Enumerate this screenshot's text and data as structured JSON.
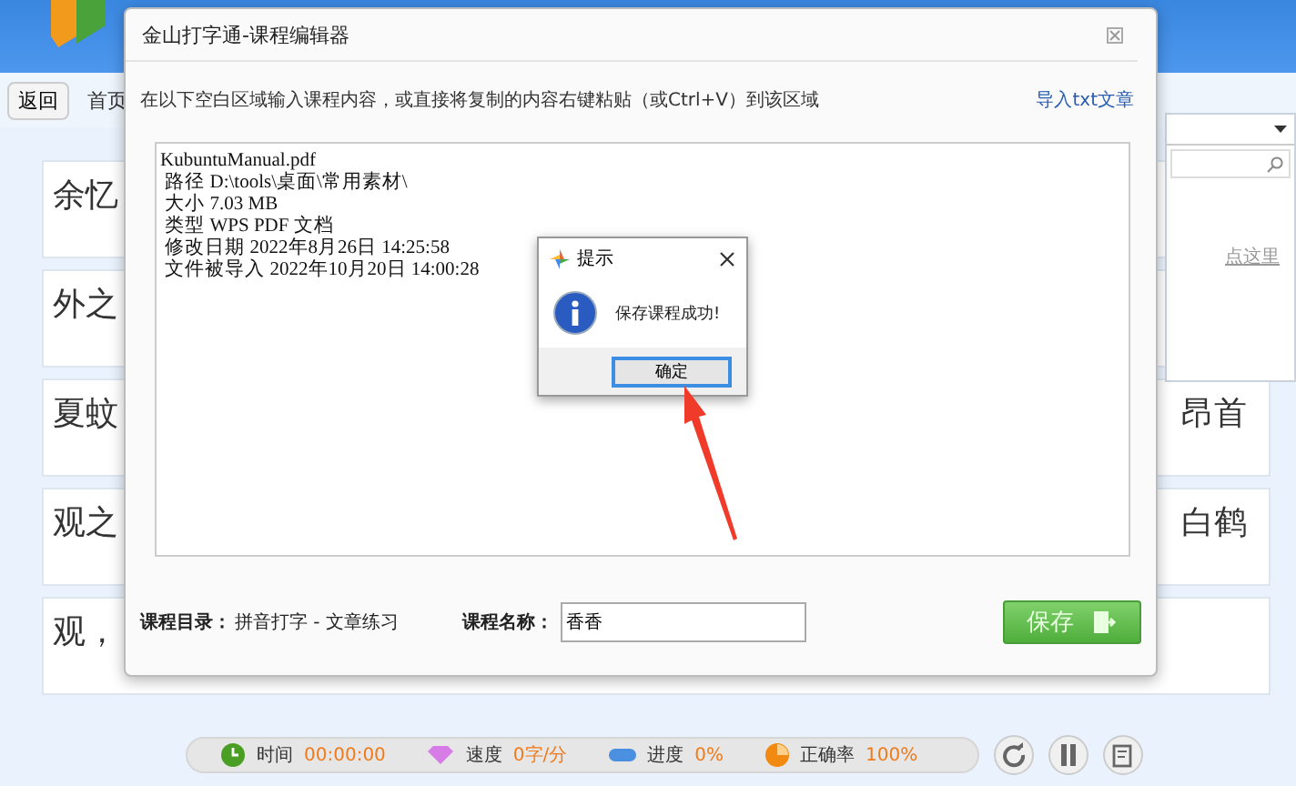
{
  "nav": {
    "back": "返回",
    "home": "首页"
  },
  "dropdown": {
    "link": "点这里"
  },
  "rows": [
    {
      "left": "余忆"
    },
    {
      "left": "外之"
    },
    {
      "left": "夏蚊",
      "right": "昂首"
    },
    {
      "left": "观之",
      "right": "白鹤"
    },
    {
      "left": "观，"
    }
  ],
  "status": [
    {
      "kind": "time",
      "label": "时间",
      "value": "00:00:00"
    },
    {
      "kind": "speed",
      "label": "速度",
      "value": "0字/分"
    },
    {
      "kind": "progress",
      "label": "进度",
      "value": "0%"
    },
    {
      "kind": "accuracy",
      "label": "正确率",
      "value": "100%"
    }
  ],
  "editor": {
    "title": "金山打字通-课程编辑器",
    "instruction": "在以下空白区域输入课程内容，或直接将复制的内容右键粘贴（或Ctrl+V）到该区域",
    "import_link": "导入txt文章",
    "content": [
      "KubuntuManual.pdf",
      " 路径 D:\\tools\\桌面\\常用素材\\",
      " 大小 7.03 MB",
      " 类型 WPS PDF 文档",
      " 修改日期 2022年8月26日 14:25:58",
      " 文件被导入 2022年10月20日 14:00:28"
    ],
    "catalog_label": "课程目录：",
    "catalog_value": "拼音打字 - 文章练习",
    "name_label": "课程名称：",
    "name_value": "香香",
    "save": "保存"
  },
  "message": {
    "title": "提示",
    "text": "保存课程成功!",
    "ok": "确定"
  }
}
